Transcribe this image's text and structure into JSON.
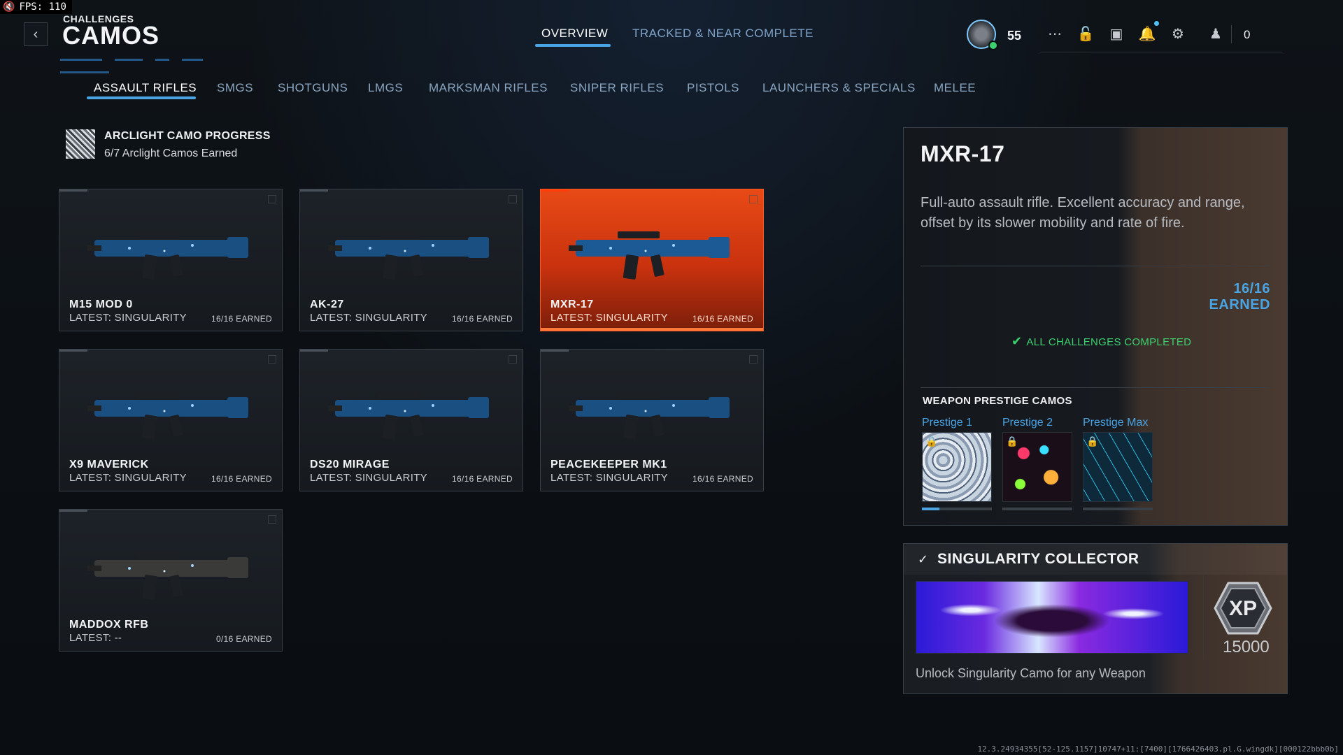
{
  "hud": {
    "fps_label": "FPS: 110"
  },
  "header": {
    "eyebrow": "CHALLENGES",
    "title": "CAMOS",
    "tabs": [
      {
        "label": "OVERVIEW",
        "active": true
      },
      {
        "label": "TRACKED & NEAR COMPLETE",
        "active": false
      }
    ],
    "player_level": "55",
    "party_count": "0",
    "icons": [
      "apps-grid-icon",
      "unlocks-icon",
      "screenshot-icon",
      "notifications-icon",
      "settings-icon",
      "party-icon"
    ]
  },
  "categories": [
    {
      "label": "ASSAULT RIFLES",
      "active": true
    },
    {
      "label": "SMGS",
      "active": false
    },
    {
      "label": "SHOTGUNS",
      "active": false
    },
    {
      "label": "LMGS",
      "active": false
    },
    {
      "label": "MARKSMAN RIFLES",
      "active": false
    },
    {
      "label": "SNIPER RIFLES",
      "active": false
    },
    {
      "label": "PISTOLS",
      "active": false
    },
    {
      "label": "LAUNCHERS & SPECIALS",
      "active": false
    },
    {
      "label": "MELEE",
      "active": false
    }
  ],
  "arclight": {
    "title": "ARCLIGHT CAMO PROGRESS",
    "subtitle": "6/7 Arclight Camos Earned"
  },
  "weapons": [
    {
      "name": "M15 MOD 0",
      "latest": "LATEST: SINGULARITY",
      "earned": "16/16 EARNED",
      "selected": false
    },
    {
      "name": "AK-27",
      "latest": "LATEST: SINGULARITY",
      "earned": "16/16 EARNED",
      "selected": false
    },
    {
      "name": "MXR-17",
      "latest": "LATEST: SINGULARITY",
      "earned": "16/16 EARNED",
      "selected": true
    },
    {
      "name": "X9 MAVERICK",
      "latest": "LATEST: SINGULARITY",
      "earned": "16/16 EARNED",
      "selected": false
    },
    {
      "name": "DS20 MIRAGE",
      "latest": "LATEST: SINGULARITY",
      "earned": "16/16 EARNED",
      "selected": false
    },
    {
      "name": "PEACEKEEPER MK1",
      "latest": "LATEST: SINGULARITY",
      "earned": "16/16 EARNED",
      "selected": false
    },
    {
      "name": "MADDOX RFB",
      "latest": "LATEST: --",
      "earned": "0/16 EARNED",
      "selected": false
    }
  ],
  "detail": {
    "name": "MXR-17",
    "description": "Full-auto assault rifle. Excellent accuracy and range, offset by its slower mobility and rate of fire.",
    "earned": "16/16 EARNED",
    "status": "ALL CHALLENGES COMPLETED",
    "prestige_title": "WEAPON PRESTIGE CAMOS",
    "prestige": [
      {
        "label": "Prestige 1",
        "locked": true,
        "progress": 0.25
      },
      {
        "label": "Prestige 2",
        "locked": true,
        "progress": 0
      },
      {
        "label": "Prestige Max",
        "locked": true,
        "progress": 0
      }
    ]
  },
  "collector": {
    "title": "SINGULARITY COLLECTOR",
    "xp_amount": "15000",
    "xp_badge_text": "XP",
    "description": "Unlock Singularity Camo for any Weapon"
  },
  "build_info": "12.3.24934355[52-125.1157]10747+11:[7400][1766426403.pl.G.wingdk][000122bbb0b]",
  "colors": {
    "accent_blue": "#4aa3e3",
    "selected_orange": "#e84a16",
    "success_green": "#3bd16f"
  }
}
